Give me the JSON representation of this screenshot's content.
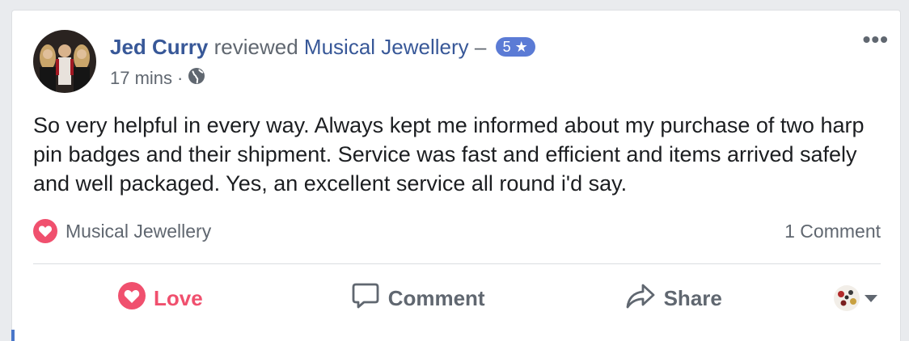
{
  "post": {
    "author": "Jed Curry",
    "action": "reviewed",
    "page_name": "Musical Jewellery",
    "dash": "–",
    "rating": "5",
    "time": "17 mins",
    "separator": "·",
    "review_text": "So very helpful in every way. Always kept me informed about my purchase of two harp pin badges and their shipment. Service was fast and efficient and items arrived safely and well packaged. Yes, an excellent service all round i'd say.",
    "reaction_by": "Musical Jewellery",
    "comment_count": "1 Comment"
  },
  "actions": {
    "love_label": "Love",
    "comment_label": "Comment",
    "share_label": "Share"
  },
  "colors": {
    "link": "#385898",
    "love": "#f0506e",
    "badge": "#5b7bd5",
    "muted": "#606770"
  }
}
